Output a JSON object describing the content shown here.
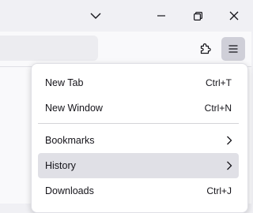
{
  "window_controls": {
    "tabs_dropdown_icon": "chevron-down-icon",
    "minimize_icon": "minimize-icon",
    "restore_icon": "restore-icon",
    "close_icon": "close-icon"
  },
  "toolbar": {
    "extensions_icon": "puzzle-piece-icon",
    "menu_icon": "hamburger-menu-icon"
  },
  "app_menu": {
    "items": [
      {
        "label": "New Tab",
        "shortcut": "Ctrl+T"
      },
      {
        "label": "New Window",
        "shortcut": "Ctrl+N"
      },
      {
        "label": "Bookmarks",
        "submenu": true
      },
      {
        "label": "History",
        "submenu": true,
        "highlighted": true
      },
      {
        "label": "Downloads",
        "shortcut": "Ctrl+J"
      }
    ]
  },
  "colors": {
    "hover": "#e0e0e6",
    "menu_button_active": "#cfcfd8"
  }
}
